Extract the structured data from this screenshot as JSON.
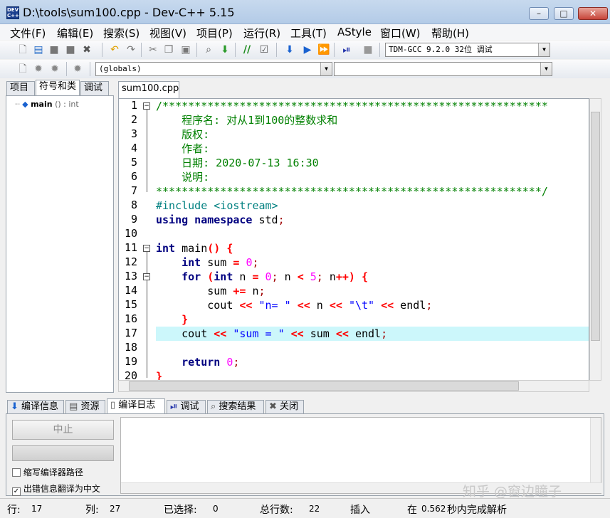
{
  "window": {
    "title": "D:\\tools\\sum100.cpp - Dev-C++ 5.15",
    "app_icon_text": "DEV\nC++",
    "minimize": "–",
    "maximize": "□",
    "close": "✕"
  },
  "menu": [
    "文件(F)",
    "编辑(E)",
    "搜索(S)",
    "视图(V)",
    "项目(P)",
    "运行(R)",
    "工具(T)",
    "AStyle",
    "窗口(W)",
    "帮助(H)"
  ],
  "toolbar": {
    "compiler_select": "TDM-GCC 9.2.0 32位 调试",
    "scope_select": "(globals)",
    "function_select": "",
    "icons": [
      "new-file-icon",
      "open-icon",
      "save-icon",
      "save-all-icon",
      "close-file-icon",
      "undo-icon",
      "redo-icon",
      "cut-icon",
      "copy-icon",
      "paste-icon",
      "find-icon",
      "goto-icon",
      "comment-icon",
      "indent-icon",
      "compile-icon",
      "run-icon",
      "compile-run-icon",
      "debug-icon",
      "stop-icon"
    ]
  },
  "left_tabs": [
    "项目",
    "符号和类",
    "调试"
  ],
  "class_tree": {
    "name": "main",
    "signature": "() : int"
  },
  "editor": {
    "tab": "sum100.cpp",
    "current_line": 17,
    "line_numbers": [
      "1",
      "2",
      "3",
      "4",
      "5",
      "6",
      "7",
      "8",
      "9",
      "10",
      "11",
      "12",
      "13",
      "14",
      "15",
      "16",
      "17",
      "18",
      "19",
      "20"
    ]
  },
  "bottom_tabs": [
    "编译信息",
    "资源",
    "编译日志",
    "调试",
    "搜索结果",
    "关闭"
  ],
  "bottom_panel": {
    "abort_button": "中止",
    "checkbox_short_path": "缩写编译器路径",
    "checkbox_translate": "出错信息翻译为中文",
    "checkbox_short_path_checked": false,
    "checkbox_translate_checked": true
  },
  "watermark": "知乎 @窗边瞳子",
  "status": {
    "row_label": "行:",
    "row_value": "17",
    "col_label": "列:",
    "col_value": "27",
    "sel_label": "已选择:",
    "sel_value": "0",
    "total_label": "总行数:",
    "total_value": "22",
    "mode": "插入",
    "parse_prefix": "在",
    "parse_time": "0.562",
    "parse_suffix": "秒内完成解析"
  }
}
